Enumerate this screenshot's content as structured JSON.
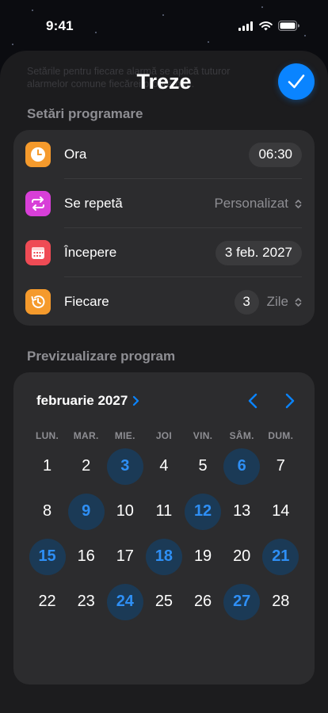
{
  "status": {
    "time": "9:41"
  },
  "sheet": {
    "title": "Treze",
    "ghost_text": "Setările pentru fiecare alarmă se aplică tuturor alarmelor comune fiecărei programări.",
    "confirm_icon": "checkmark-icon",
    "accent": "#0a84ff"
  },
  "settings": {
    "header": "Setări programare",
    "ora": {
      "label": "Ora",
      "value": "06:30",
      "icon": "clock-icon",
      "color": "#f59a2c"
    },
    "repeat": {
      "label": "Se repetă",
      "value": "Personalizat",
      "icon": "repeat-icon",
      "color": "#d83fd8"
    },
    "start": {
      "label": "Începere",
      "value": "3 feb. 2027",
      "icon": "calendar-icon",
      "color": "#ef4b55"
    },
    "every": {
      "label": "Fiecare",
      "number": "3",
      "unit": "Zile",
      "icon": "history-icon",
      "color": "#f59a2c"
    }
  },
  "preview": {
    "header": "Previzualizare program",
    "month": "februarie 2027",
    "weekdays": [
      "LUN.",
      "MAR.",
      "MIE.",
      "JOI",
      "VIN.",
      "SÂM.",
      "DUM."
    ],
    "weeks": [
      [
        {
          "d": "1",
          "hl": false
        },
        {
          "d": "2",
          "hl": false
        },
        {
          "d": "3",
          "hl": true
        },
        {
          "d": "4",
          "hl": false
        },
        {
          "d": "5",
          "hl": false
        },
        {
          "d": "6",
          "hl": true
        },
        {
          "d": "7",
          "hl": false
        }
      ],
      [
        {
          "d": "8",
          "hl": false
        },
        {
          "d": "9",
          "hl": true
        },
        {
          "d": "10",
          "hl": false
        },
        {
          "d": "11",
          "hl": false
        },
        {
          "d": "12",
          "hl": true
        },
        {
          "d": "13",
          "hl": false
        },
        {
          "d": "14",
          "hl": false
        }
      ],
      [
        {
          "d": "15",
          "hl": true
        },
        {
          "d": "16",
          "hl": false
        },
        {
          "d": "17",
          "hl": false
        },
        {
          "d": "18",
          "hl": true
        },
        {
          "d": "19",
          "hl": false
        },
        {
          "d": "20",
          "hl": false
        },
        {
          "d": "21",
          "hl": true
        }
      ],
      [
        {
          "d": "22",
          "hl": false
        },
        {
          "d": "23",
          "hl": false
        },
        {
          "d": "24",
          "hl": true
        },
        {
          "d": "25",
          "hl": false
        },
        {
          "d": "26",
          "hl": false
        },
        {
          "d": "27",
          "hl": true
        },
        {
          "d": "28",
          "hl": false
        }
      ]
    ]
  }
}
